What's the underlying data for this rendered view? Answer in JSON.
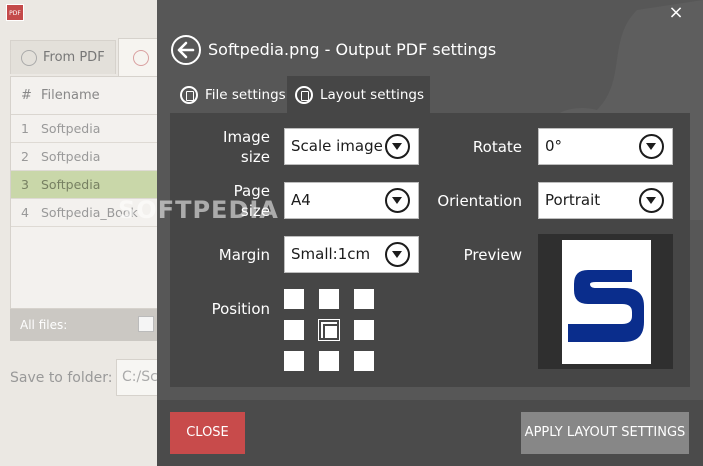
{
  "bg_app": {
    "logo_text": "PDF",
    "tabs": [
      {
        "label": "From PDF"
      }
    ],
    "table": {
      "headers": [
        "#",
        "Filename"
      ],
      "rows": [
        {
          "num": "1",
          "name": "Softpedia"
        },
        {
          "num": "2",
          "name": "Softpedia"
        },
        {
          "num": "3",
          "name": "Softpedia"
        },
        {
          "num": "4",
          "name": "Softpedia_Book"
        }
      ],
      "selected_row": 3
    },
    "all_files_label": "All files:",
    "save_to_folder_label": "Save to folder:",
    "save_to_folder_value": "C:/Sc"
  },
  "watermark": "SOFTPEDIA",
  "modal": {
    "close_x": "×",
    "title": "Softpedia.png - Output PDF settings",
    "tabs": {
      "file_settings": "File settings",
      "layout_settings": "Layout settings",
      "active": "layout_settings"
    },
    "image_size": {
      "label_line1": "Image",
      "label_line2": "size",
      "value": "Scale image"
    },
    "page_size": {
      "label_line1": "Page",
      "label_line2": "size",
      "value": "A4"
    },
    "margin": {
      "label": "Margin",
      "value": "Small:1cm"
    },
    "rotate": {
      "label": "Rotate",
      "value": "0°"
    },
    "orientation": {
      "label": "Orientation",
      "value": "Portrait"
    },
    "position": {
      "label": "Position",
      "selected": "middle-center"
    },
    "preview": {
      "label": "Preview",
      "image_letter": "S",
      "image_color": "#0a2d8c"
    },
    "buttons": {
      "close": "CLOSE",
      "apply": "APPLY LAYOUT SETTINGS"
    }
  },
  "colors": {
    "modal_bg": "#575757",
    "panel_bg": "#464646",
    "close_button": "#c84b4b",
    "apply_button": "#878787",
    "selected_row": "#c9d7a9"
  }
}
